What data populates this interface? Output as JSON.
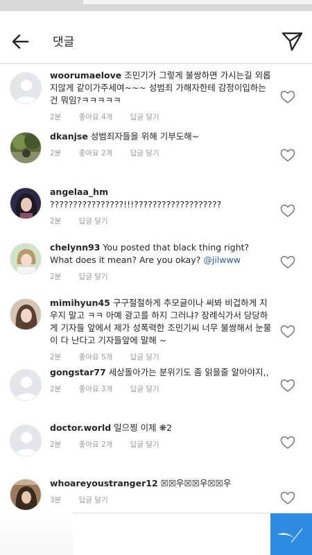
{
  "header": {
    "title": "댓글"
  },
  "comments": [
    {
      "username": "woorumaelove",
      "text": "조민기가 그렇게 불쌍하면 가시는길 외롭지않게 같이가주세여~~~ 성범죄 가해자한테 감정이입하는건 뭐임?ㅋㅋㅋㅋㅋ",
      "time": "2분",
      "likes": "좋아요 4개",
      "reply": "답글 달기"
    },
    {
      "username": "dkanjse",
      "text": "성범죄자들을 위해 기부도해~",
      "time": "2분",
      "likes": "좋아요 2개",
      "reply": "답글 달기"
    },
    {
      "username": "angelaa_hm",
      "text": "????????????????!!!???????????????????",
      "time": "2분",
      "reply": "답글 달기"
    },
    {
      "username": "chelynn93",
      "text": "You posted that black thing right? What does it mean? Are you okay?",
      "mention": "@jilwww",
      "time": "2분",
      "reply": "답글 달기"
    },
    {
      "username": "mimihyun45",
      "text": "구구절절하게 추모글이나 써봐 비겁하게 지우지 말고 ㅋㅋ 아예 광고를 하지 그러냐? 장례식가서 당당하게 기자들 앞에서 제가 성폭력한 조민기씨 너무 불쌍해서 눈물이 다 난다고 기자들앞에 말해 ~",
      "time": "2분",
      "likes": "좋아요 5개",
      "reply": "답글 달기"
    },
    {
      "username": "gongstar77",
      "text": "세상돌아가는 분위기도 좀 읽을줄 알아야지,,",
      "time": "2분",
      "likes": "좋아요 3개",
      "reply": "답글 달기"
    },
    {
      "username": "doctor.world",
      "text": "일으찡 이제 ❋2",
      "time": "2분",
      "likes": "좋아요 2개",
      "reply": "답글 달기"
    },
    {
      "username": "whoareyoustranger12",
      "text": "☒☒우☒☒우☒☒우",
      "time": "3분",
      "reply": "답글 달기"
    }
  ]
}
